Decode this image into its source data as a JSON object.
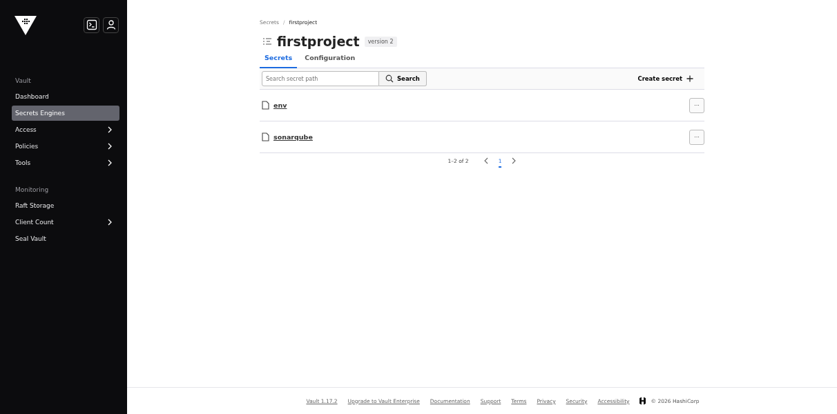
{
  "sidebar": {
    "sections": [
      {
        "heading": "Vault",
        "items": [
          {
            "label": "Dashboard",
            "selected": false,
            "has_submenu": false
          },
          {
            "label": "Secrets Engines",
            "selected": true,
            "has_submenu": false
          },
          {
            "label": "Access",
            "selected": false,
            "has_submenu": true
          },
          {
            "label": "Policies",
            "selected": false,
            "has_submenu": true
          },
          {
            "label": "Tools",
            "selected": false,
            "has_submenu": true
          }
        ]
      },
      {
        "heading": "Monitoring",
        "items": [
          {
            "label": "Raft Storage",
            "selected": false,
            "has_submenu": false
          },
          {
            "label": "Client Count",
            "selected": false,
            "has_submenu": true
          },
          {
            "label": "Seal Vault",
            "selected": false,
            "has_submenu": false
          }
        ]
      }
    ]
  },
  "breadcrumb": [
    {
      "label": "Secrets",
      "current": false
    },
    {
      "label": "firstproject",
      "current": true
    }
  ],
  "breadcrumb_separator": "/",
  "page_title": "firstproject",
  "version_badge": "version 2",
  "tabs": [
    {
      "label": "Secrets",
      "selected": true
    },
    {
      "label": "Configuration",
      "selected": false
    }
  ],
  "search": {
    "placeholder": "Search secret path",
    "button": "Search"
  },
  "create_button": "Create secret",
  "secrets": [
    {
      "name": "env",
      "menu": "···"
    },
    {
      "name": "sonarqube",
      "menu": "···"
    }
  ],
  "pagination": {
    "range": "1–2 of 2",
    "pages": [
      {
        "label": "1",
        "selected": true
      }
    ]
  },
  "footer": {
    "links": [
      "Vault 1.17.2",
      "Upgrade to Vault Enterprise",
      "Documentation",
      "Support",
      "Terms",
      "Privacy",
      "Security",
      "Accessibility"
    ],
    "copyright": "© 2026 HashiCorp"
  }
}
